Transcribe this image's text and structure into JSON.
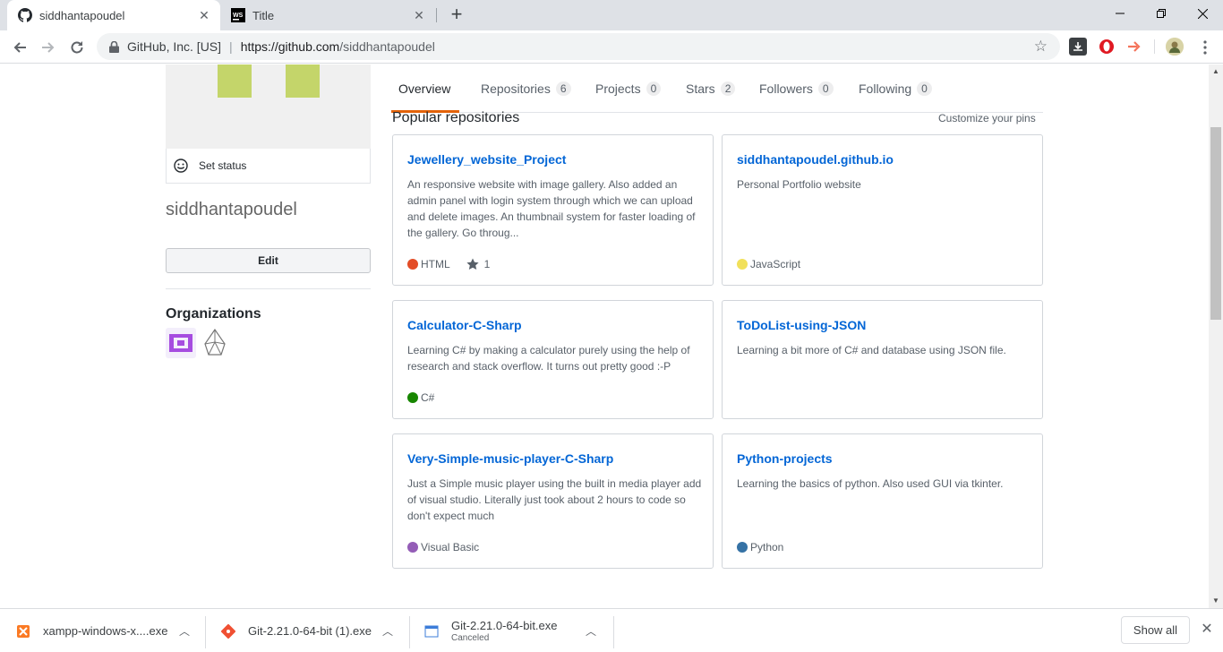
{
  "browser": {
    "tabs": [
      {
        "title": "siddhantapoudel",
        "icon": "github-icon",
        "active": true
      },
      {
        "title": "Title",
        "icon": "webstorm-icon",
        "active": false
      }
    ],
    "site_identity": "GitHub, Inc. [US]",
    "url_host": "https://github.com",
    "url_path": "/siddhantapoudel"
  },
  "sidebar": {
    "set_status_label": "Set status",
    "username": "siddhantapoudel",
    "edit_label": "Edit",
    "organizations_title": "Organizations"
  },
  "profile_tabs": [
    {
      "label": "Overview",
      "count": null
    },
    {
      "label": "Repositories",
      "count": "6"
    },
    {
      "label": "Projects",
      "count": "0"
    },
    {
      "label": "Stars",
      "count": "2"
    },
    {
      "label": "Followers",
      "count": "0"
    },
    {
      "label": "Following",
      "count": "0"
    }
  ],
  "popular": {
    "title": "Popular repositories",
    "customize_label": "Customize your pins",
    "repos": [
      {
        "name": "Jewellery_website_Project",
        "description": "An responsive website with image gallery. Also added an admin panel with login system through which we can upload and delete images. An thumbnail system for faster loading of the gallery. Go throug...",
        "language": "HTML",
        "language_color": "#e34c26",
        "stars": "1"
      },
      {
        "name": "siddhantapoudel.github.io",
        "description": "Personal Portfolio website",
        "language": "JavaScript",
        "language_color": "#f1e05a",
        "stars": null
      },
      {
        "name": "Calculator-C-Sharp",
        "description": "Learning C# by making a calculator purely using the help of research and stack overflow. It turns out pretty good :-P",
        "language": "C#",
        "language_color": "#178600",
        "stars": null
      },
      {
        "name": "ToDoList-using-JSON",
        "description": "Learning a bit more of C# and database using JSON file.",
        "language": null,
        "language_color": null,
        "stars": null
      },
      {
        "name": "Very-Simple-music-player-C-Sharp",
        "description": "Just a Simple music player using the built in media player add of visual studio. Literally just took about 2 hours to code so don't expect much",
        "language": "Visual Basic",
        "language_color": "#945db7",
        "stars": null
      },
      {
        "name": "Python-projects",
        "description": "Learning the basics of python. Also used GUI via tkinter.",
        "language": "Python",
        "language_color": "#3572A5",
        "stars": null
      }
    ]
  },
  "downloads": {
    "items": [
      {
        "name": "xampp-windows-x....exe",
        "status": null
      },
      {
        "name": "Git-2.21.0-64-bit (1).exe",
        "status": null
      },
      {
        "name": "Git-2.21.0-64-bit.exe",
        "status": "Canceled"
      }
    ],
    "show_all_label": "Show all"
  }
}
